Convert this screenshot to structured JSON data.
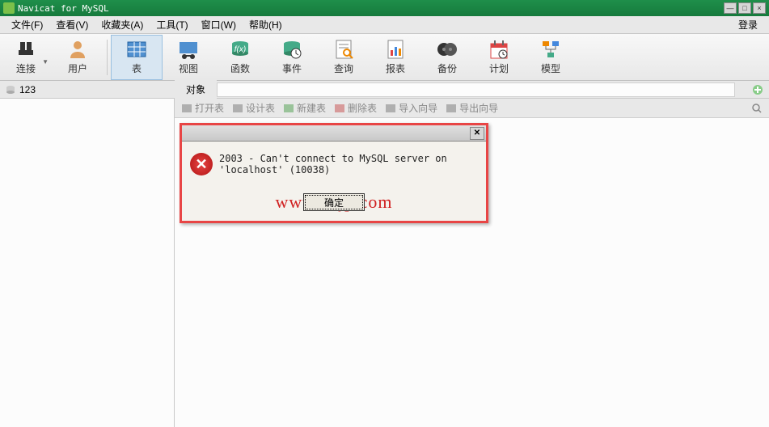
{
  "title": "Navicat for MySQL",
  "menu": [
    "文件(F)",
    "查看(V)",
    "收藏夹(A)",
    "工具(T)",
    "窗口(W)",
    "帮助(H)"
  ],
  "login": "登录",
  "toolbar": [
    {
      "label": "连接",
      "icon": "plug",
      "drop": true
    },
    {
      "label": "用户",
      "icon": "user"
    },
    {
      "sep": true
    },
    {
      "label": "表",
      "icon": "table",
      "active": true
    },
    {
      "label": "视图",
      "icon": "view"
    },
    {
      "label": "函数",
      "icon": "fx"
    },
    {
      "label": "事件",
      "icon": "event"
    },
    {
      "label": "查询",
      "icon": "query"
    },
    {
      "label": "报表",
      "icon": "report"
    },
    {
      "label": "备份",
      "icon": "backup"
    },
    {
      "label": "计划",
      "icon": "schedule"
    },
    {
      "label": "模型",
      "icon": "model"
    }
  ],
  "sidebar_item": "123",
  "tab": "对象",
  "actions": [
    "打开表",
    "设计表",
    "新建表",
    "删除表",
    "导入向导",
    "导出向导"
  ],
  "dialog": {
    "message": "2003 - Can't connect to MySQL server on 'localhost' (10038)",
    "ok": "确定"
  },
  "watermark": "www.e4jp.com"
}
